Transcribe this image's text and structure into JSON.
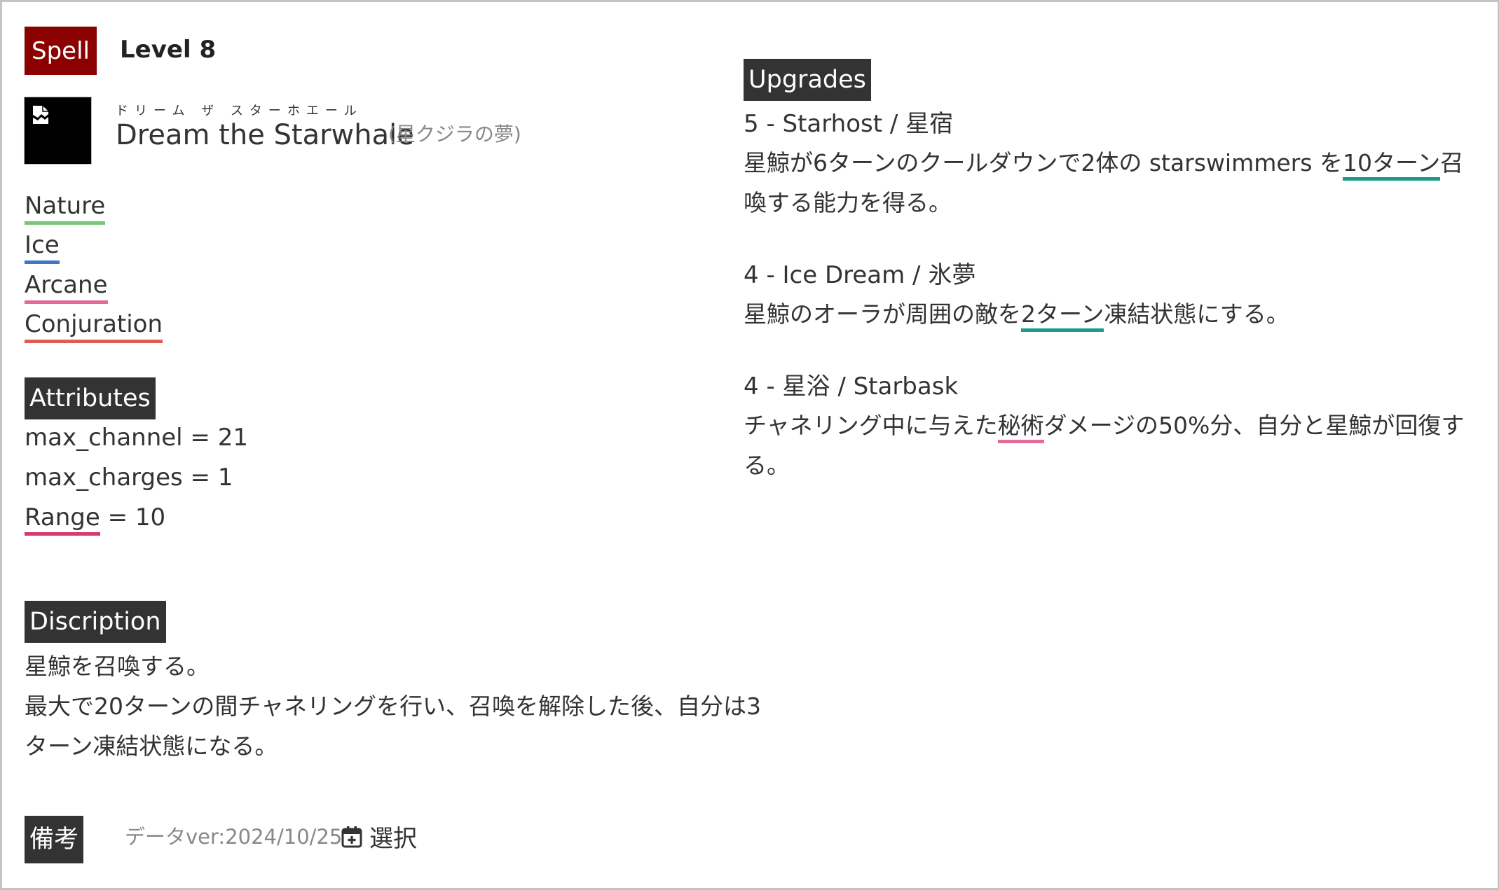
{
  "header": {
    "badge": "Spell",
    "level": "Level 8"
  },
  "spell": {
    "ruby": "ドリーム ザ スターホエール",
    "name": "Dream the Starwhale",
    "name_jp": "(星クジラの夢)",
    "icon": "broken-image-icon"
  },
  "tags": [
    {
      "label": "Nature",
      "color": "#77c77a"
    },
    {
      "label": "Ice",
      "color": "#3b77c9"
    },
    {
      "label": "Arcane",
      "color": "#e36a9a"
    },
    {
      "label": "Conjuration",
      "color": "#e25a55"
    }
  ],
  "attributes": {
    "heading": "Attributes",
    "items": [
      {
        "text": "max_channel = 21"
      },
      {
        "text": "max_charges = 1"
      },
      {
        "key": "Range",
        "value": " = 10"
      }
    ]
  },
  "description": {
    "heading": "Discription",
    "lines": [
      "星鯨を召喚する。",
      "最大で20ターンの間チャネリングを行い、召喚を解除した後、自分は3",
      "ターン凍結状態になる。"
    ]
  },
  "upgrades": {
    "heading": "Upgrades",
    "items": [
      {
        "title": "5 - Starhost / 星宿",
        "line1_pre": "星鯨が6ターンのクールダウンで2体の starswimmers を",
        "line1_link": "10ターン",
        "line1_post": "召",
        "line2": "喚する能力を得る。"
      },
      {
        "title": "4 - Ice Dream / 氷夢",
        "line1_pre": "星鯨のオーラが周囲の敵を",
        "line1_link": "2ターン",
        "line1_post": "凍結状態にする。"
      },
      {
        "title": "4 - 星浴 / Starbask",
        "line1_pre": "チャネリング中に与えた",
        "line1_link": "秘術",
        "line1_post": "ダメージの50%分、自分と星鯨が回復す",
        "line2": "る。"
      }
    ]
  },
  "footer": {
    "note_label": "備考",
    "data_version": "データver:2024/10/25",
    "select_label": "選択",
    "select_icon": "calendar-plus-icon"
  },
  "colors": {
    "spell_badge": "#8b0000",
    "header_bg": "#333333",
    "upgrade_link": "#1f9a8a",
    "arcane_link": "#e36a9a",
    "range_link": "#d93873"
  }
}
